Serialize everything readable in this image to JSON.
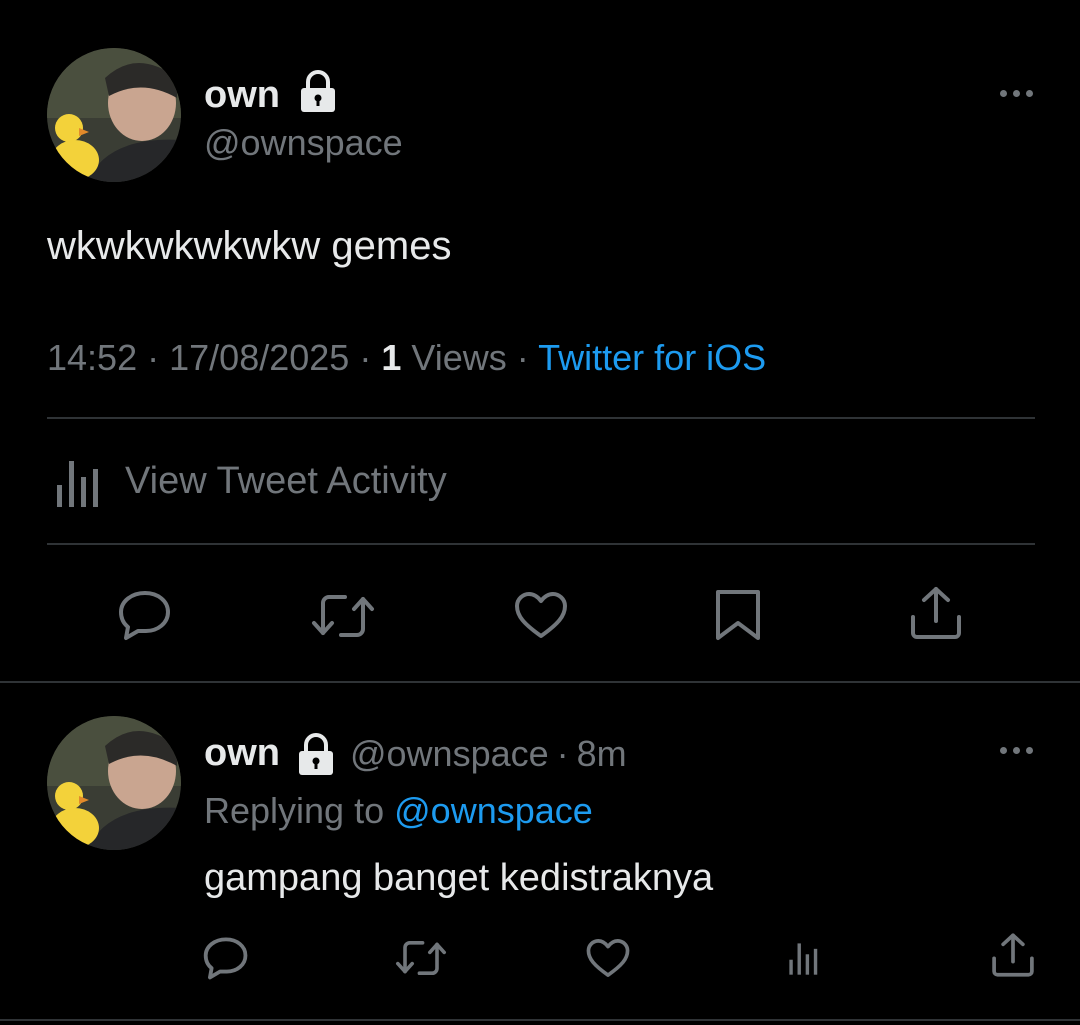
{
  "main_tweet": {
    "display_name": "own",
    "handle": "@ownspace",
    "text": "wkwkwkwkwkw gemes",
    "time": "14:52",
    "sep1": "·",
    "date": "17/08/2025",
    "sep2": "·",
    "views_count": "1",
    "views_label": "Views",
    "sep3": "·",
    "source": "Twitter for iOS",
    "activity_label": "View Tweet Activity"
  },
  "reply": {
    "display_name": "own",
    "handle": "@ownspace",
    "sep": "·",
    "time_ago": "8m",
    "replying_prefix": "Replying to",
    "replying_handle": "@ownspace",
    "text": "gampang banget kedistraknya"
  },
  "icons": {
    "lock": "lock-icon",
    "more": "more-icon",
    "reply": "reply-icon",
    "retweet": "retweet-icon",
    "like": "like-icon",
    "bookmark": "bookmark-icon",
    "share": "share-icon",
    "analytics": "analytics-icon"
  },
  "colors": {
    "background": "#000000",
    "text": "#e7e9ea",
    "muted": "#71767b",
    "link": "#1d9bf0",
    "divider": "#2f3336"
  }
}
